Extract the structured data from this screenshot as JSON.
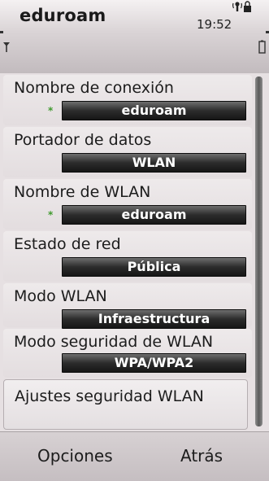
{
  "status_bar": {
    "app_title": "eduroam",
    "time": "19:52",
    "icons": [
      "wlan-connection-icon",
      "signal-strength-icon",
      "battery-icon"
    ]
  },
  "settings": [
    {
      "label": "Nombre de conexión",
      "value": "eduroam",
      "required": true
    },
    {
      "label": "Portador de datos",
      "value": "WLAN",
      "required": false
    },
    {
      "label": "Nombre de WLAN",
      "value": "eduroam",
      "required": true
    },
    {
      "label": "Estado de red",
      "value": "Pública",
      "required": false
    },
    {
      "label": "Modo WLAN",
      "value": "Infraestructura",
      "required": false
    },
    {
      "label": "Modo seguridad de WLAN",
      "value": "WPA/WPA2",
      "required": false
    }
  ],
  "required_marker": "*",
  "last_item": {
    "label": "Ajustes seguridad WLAN"
  },
  "softkeys": {
    "left": "Opciones",
    "right": "Atrás"
  },
  "colors": {
    "value_field_bg": "#1e1e1e",
    "value_field_text": "#ffffff",
    "required_marker": "#3f9a2e",
    "list_bg": "#e6e0e2"
  }
}
